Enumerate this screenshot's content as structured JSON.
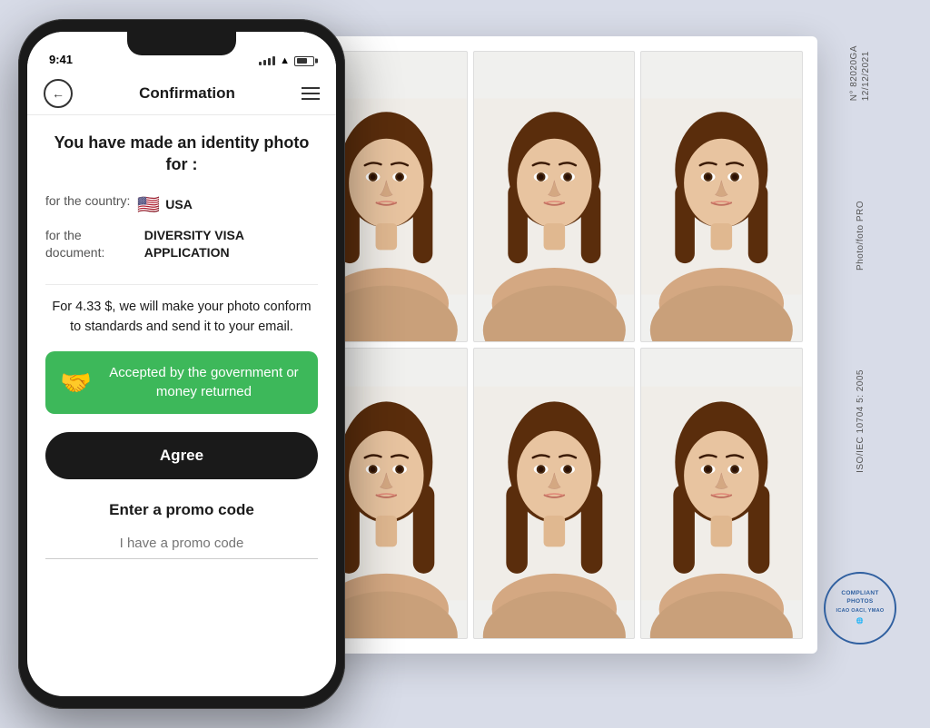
{
  "background_color": "#d8dce8",
  "phone": {
    "status_bar": {
      "time": "9:41",
      "signal": "signal",
      "wifi": "wifi",
      "battery": "battery"
    },
    "nav": {
      "back_label": "‹",
      "title": "Confirmation",
      "menu_label": "≡"
    },
    "content": {
      "headline": "You have made an identity photo for :",
      "country_label": "for the country:",
      "country_flag": "🇺🇸",
      "country_name": "USA",
      "document_label": "for the document:",
      "document_name": "DIVERSITY VISA APPLICATION",
      "price_text": "For 4.33 $, we will make your photo conform to standards and send it to your email.",
      "guarantee": {
        "icon": "🤝",
        "text": "Accepted by the government or money returned"
      },
      "agree_button_label": "Agree",
      "promo_title": "Enter a promo code",
      "promo_placeholder": "I have a promo code"
    }
  },
  "photo_sheet": {
    "photos_count": 6,
    "columns": 3,
    "rows": 2,
    "label_number": "N° 82020GA",
    "label_date": "12/12/2021",
    "label_brand": "Photo/foto PRO",
    "label_standard": "ISO/IEC 10704 5: 2005",
    "stamp_text": "COMPLIANT PHOTOS",
    "stamp_subtext": "ICAO OACI, YMAO"
  },
  "colors": {
    "green": "#3db85a",
    "dark": "#1a1a1a",
    "stamp_blue": "#3060a0",
    "bg": "#d8dce8"
  }
}
